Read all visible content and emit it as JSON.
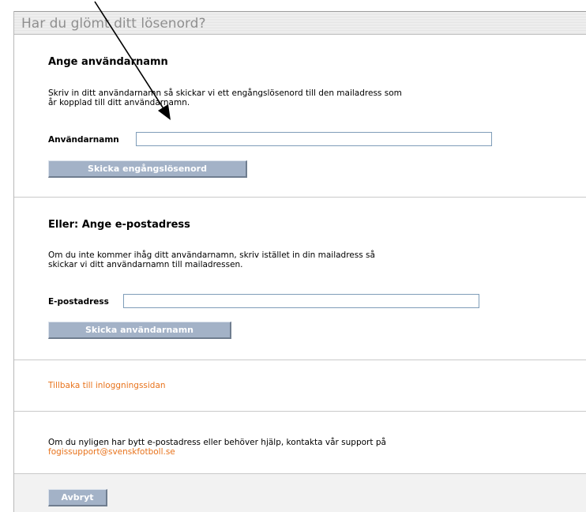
{
  "page": {
    "title": "Har du glömt ditt lösenord?"
  },
  "username_section": {
    "title": "Ange användarnamn",
    "description": "Skriv in ditt användarnamn så skickar vi ett engångslösenord till den mailadress som\når kopplad till ditt användarnamn.",
    "field_label": "Användarnamn",
    "field_value": "",
    "button_label": "Skicka engångslösenord"
  },
  "email_section": {
    "title": "Eller: Ange e-postadress",
    "description": "Om du inte kommer ihåg ditt användarnamn, skriv istället in din mailadress så\nskickar vi ditt användarnamn till mailadressen.",
    "field_label": "E-postadress",
    "field_value": "",
    "button_label": "Skicka användarnamn"
  },
  "back_section": {
    "link_text": "Tillbaka till inloggningssidan"
  },
  "support_section": {
    "text": "Om du nyligen har bytt e-postadress eller behöver hjälp, kontakta vår support på",
    "email_link": "fogissupport@svenskfotboll.se"
  },
  "footer": {
    "cancel_label": "Avbryt"
  },
  "colors": {
    "link": "#e8731c",
    "button_bg": "#a3b2c7",
    "header_text": "#8f8f8f"
  }
}
